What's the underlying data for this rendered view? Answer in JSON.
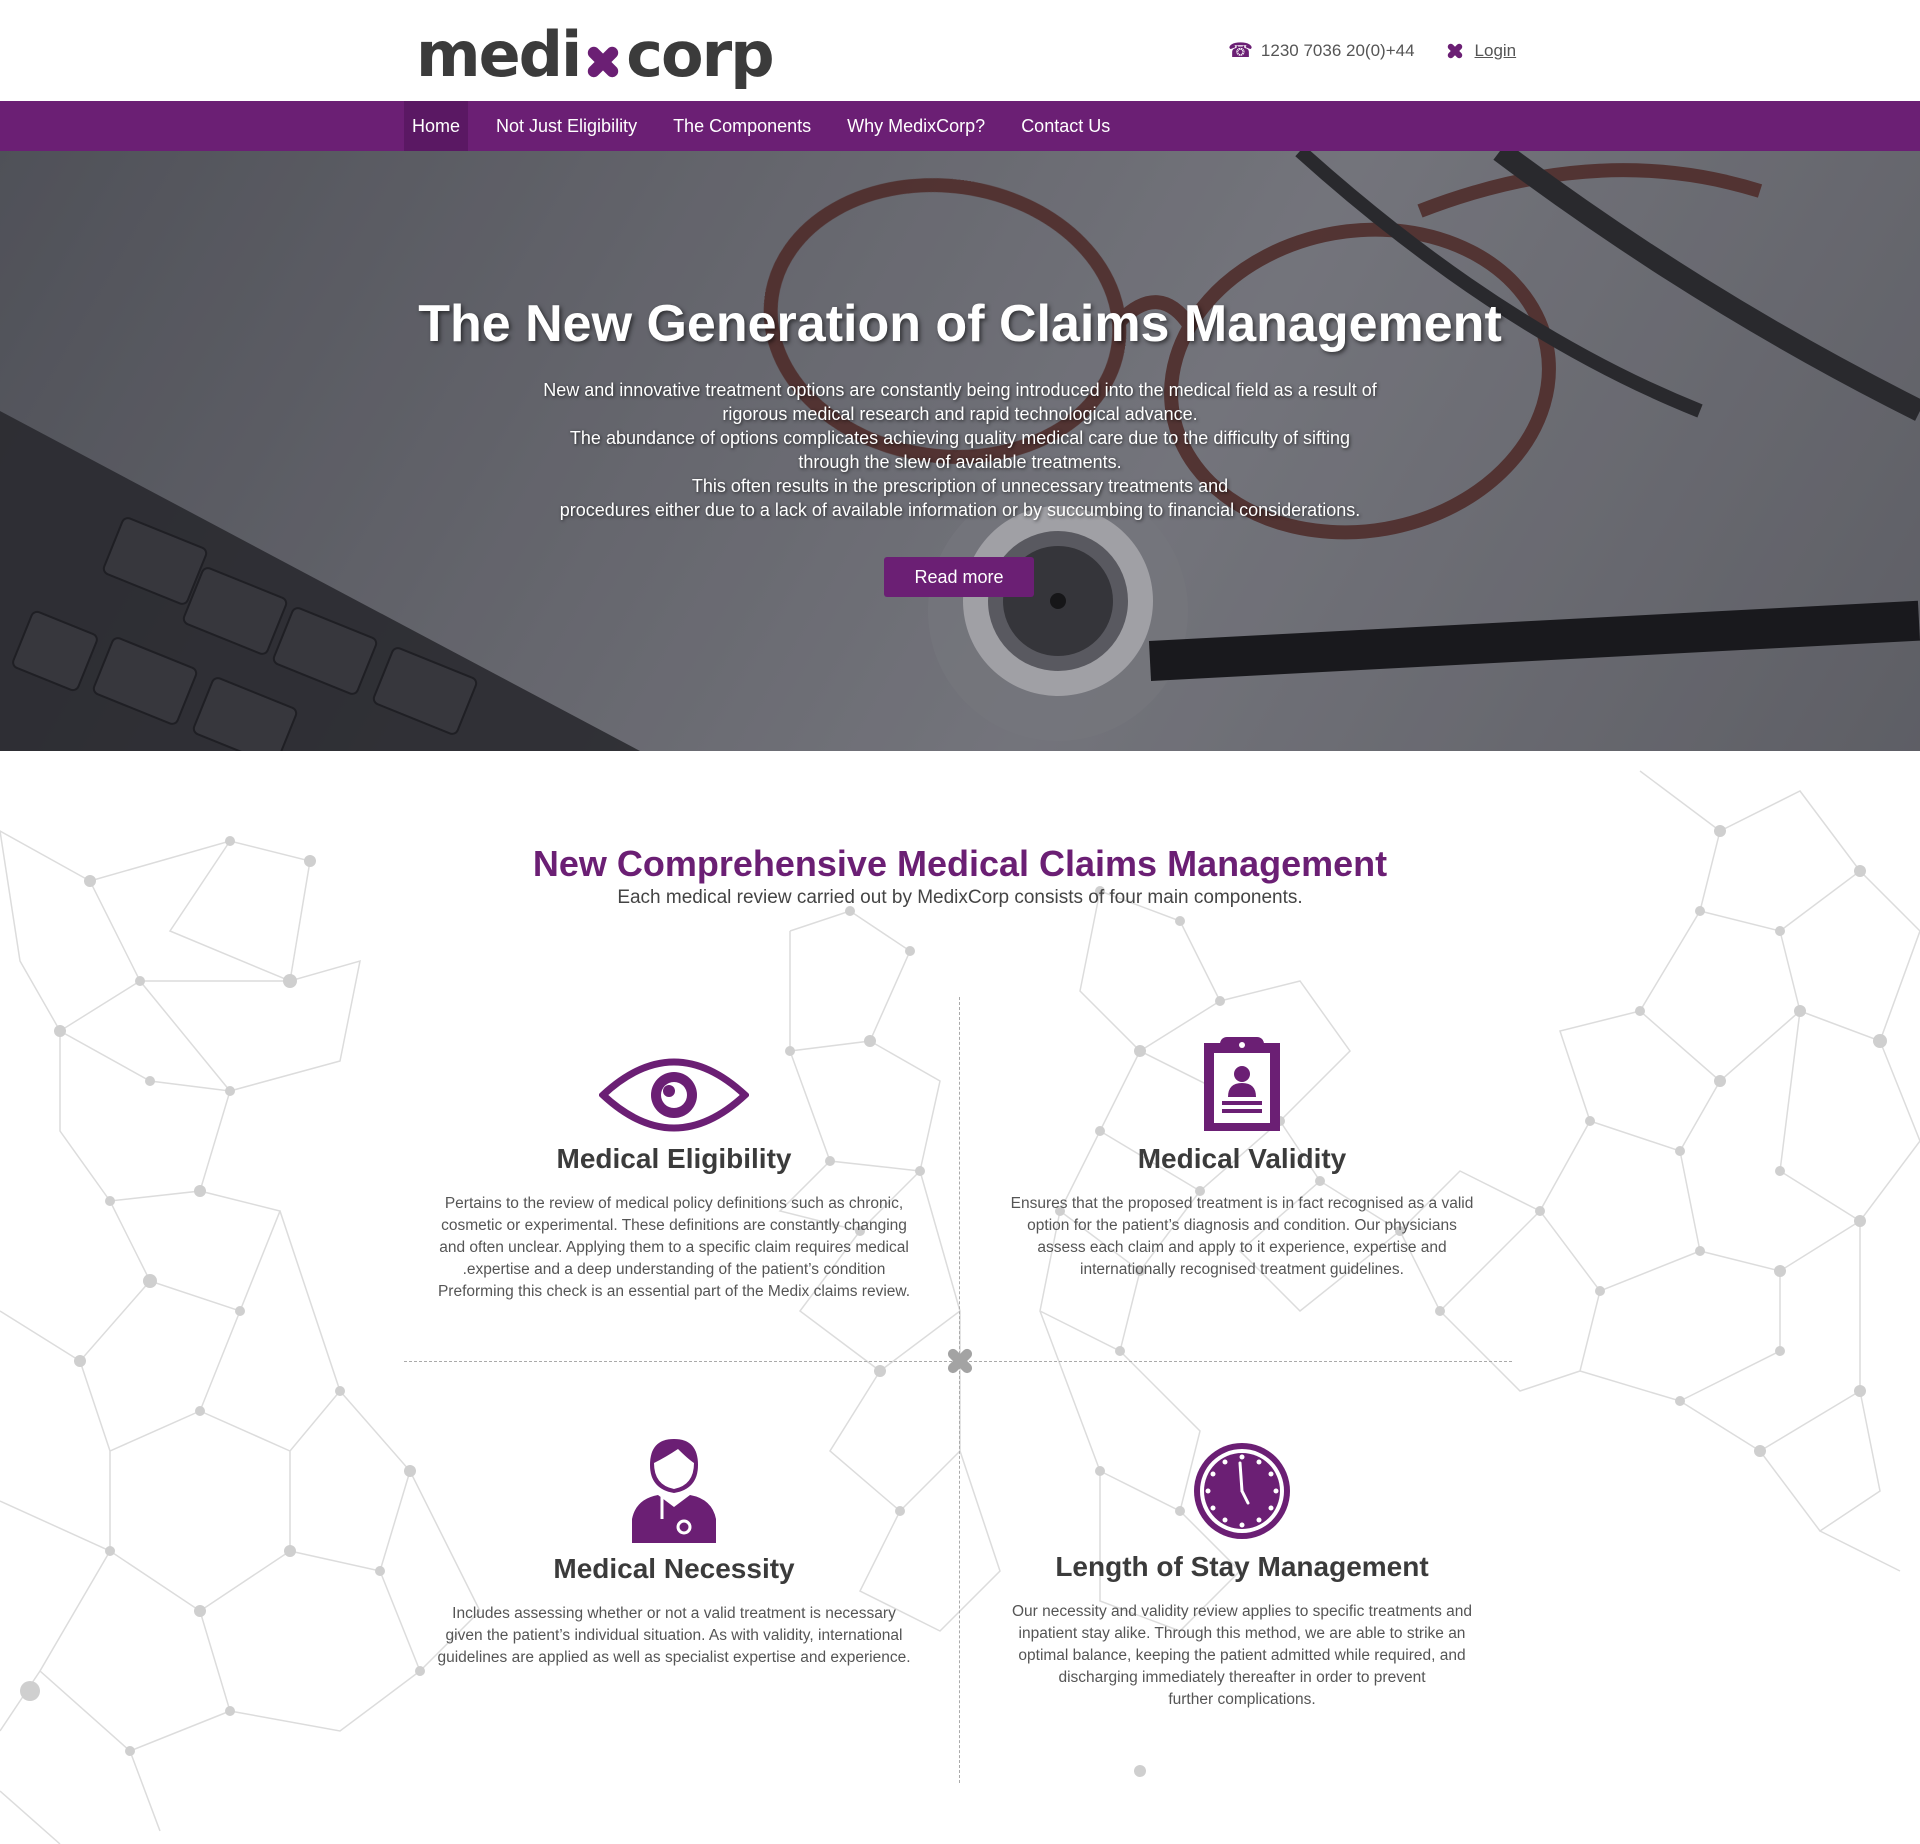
{
  "brand": {
    "logo_left": "medi",
    "logo_right": "corp",
    "accent": "#6b1f74"
  },
  "header": {
    "phone": "1230 7036 20(0)+44",
    "login_label": "Login",
    "phone_icon": "phone-icon",
    "login_icon": "x-cross-icon"
  },
  "nav": {
    "items": [
      {
        "label": "Home",
        "active": true
      },
      {
        "label": "Not Just Eligibility"
      },
      {
        "label": "The Components"
      },
      {
        "label": "Why MedixCorp?"
      },
      {
        "label": "Contact Us"
      }
    ]
  },
  "hero": {
    "title": "The New Generation of Claims Management",
    "lines": [
      "New and innovative treatment options are constantly being introduced into the medical field as a result of",
      "rigorous medical research and rapid technological advance.",
      "The abundance of options complicates achieving quality medical care due to the difficulty of sifting",
      "through the slew of available treatments.",
      "This often results in the prescription of unnecessary treatments and",
      "procedures either due to a lack of available information  or by succumbing to financial considerations."
    ],
    "button_label": "Read more"
  },
  "section": {
    "title": "New Comprehensive Medical Claims Management",
    "subtitle": "Each medical review carried out by MedixCorp consists of four main components."
  },
  "components": [
    {
      "title": "Medical Eligibility",
      "icon": "eye-icon",
      "lines": [
        "Pertains to the review of medical policy definitions such as chronic,",
        "cosmetic or experimental. These definitions are constantly changing",
        "and often unclear. Applying them to a specific claim requires medical",
        ".expertise and a deep understanding of the patient’s condition",
        "Preforming this check is an essential part of the Medix claims review."
      ]
    },
    {
      "title": "Medical Validity",
      "icon": "clipboard-icon",
      "lines": [
        "Ensures that the proposed treatment is in fact recognised as a valid",
        "option for the patient’s diagnosis and condition. Our physicians",
        "assess each claim and apply to it experience, expertise and",
        "internationally recognised treatment guidelines."
      ]
    },
    {
      "title": "Medical Necessity",
      "icon": "doctor-icon",
      "lines": [
        "Includes assessing whether or not a valid treatment is necessary",
        "given the patient’s individual situation. As with validity, international",
        "guidelines are applied as well as specialist expertise and experience."
      ]
    },
    {
      "title": "Length of Stay Management",
      "icon": "clock-icon",
      "lines": [
        "Our necessity and validity review applies to specific treatments and",
        "inpatient stay alike. Through this method, we are able to strike an",
        "optimal balance, keeping the patient admitted while required, and",
        "discharging immediately thereafter in order to prevent",
        "further complications."
      ]
    }
  ]
}
